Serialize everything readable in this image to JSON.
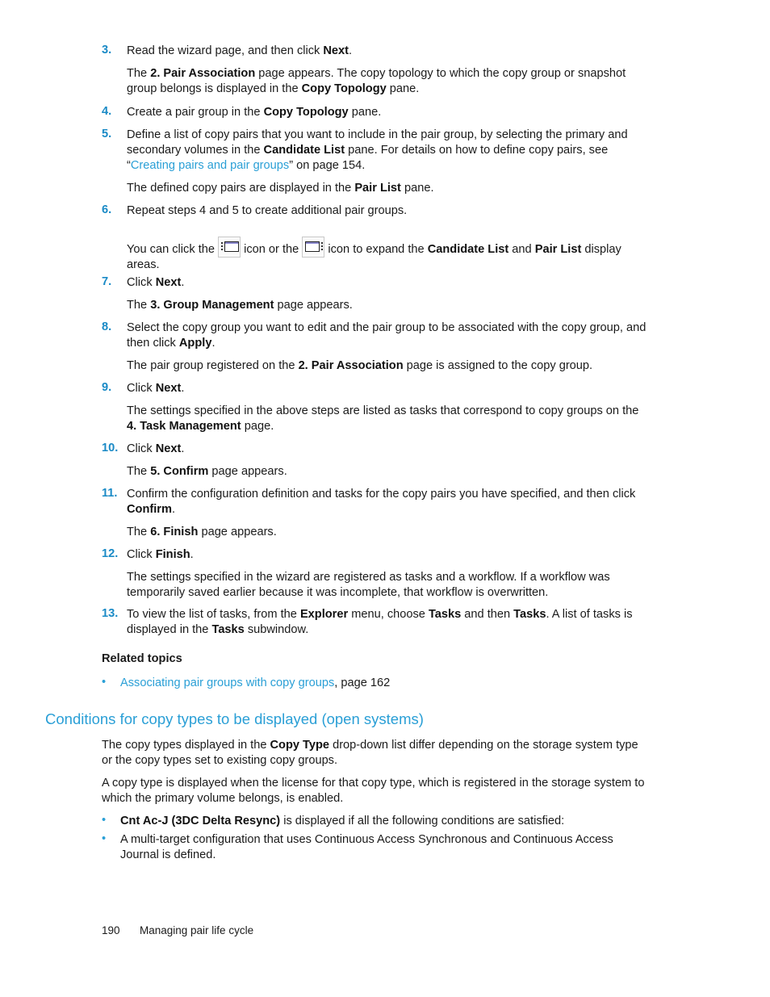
{
  "steps": [
    {
      "num": "3.",
      "line": [
        "Read the wizard page, and then click ",
        "Next",
        "."
      ],
      "note": [
        "The ",
        "2. Pair Association",
        " page appears. The copy topology to which the copy group or snapshot group belongs is displayed in the ",
        "Copy Topology",
        " pane."
      ]
    },
    {
      "num": "4.",
      "line": [
        "Create a pair group in the ",
        "Copy Topology",
        " pane."
      ]
    },
    {
      "num": "5.",
      "line": [
        "Define a list of copy pairs that you want to include in the pair group, by selecting the primary and secondary volumes in the ",
        "Candidate List",
        " pane. For details on how to define copy pairs, see “",
        "Creating pairs and pair groups",
        "” on page 154."
      ],
      "note": [
        "The defined copy pairs are displayed in the ",
        "Pair List",
        " pane."
      ]
    },
    {
      "num": "6.",
      "line": [
        "Repeat steps 4 and 5 to create additional pair groups."
      ],
      "note": [
        "You can click the ",
        " icon or the ",
        " icon to expand the ",
        "Candidate List",
        " and ",
        "Pair List",
        " display areas."
      ]
    },
    {
      "num": "7.",
      "line": [
        "Click ",
        "Next",
        "."
      ],
      "note": [
        "The ",
        "3. Group Management",
        " page appears."
      ]
    },
    {
      "num": "8.",
      "line": [
        "Select the copy group you want to edit and the pair group to be associated with the copy group, and then click ",
        "Apply",
        "."
      ],
      "note": [
        "The pair group registered on the ",
        "2. Pair Association",
        " page is assigned to the copy group."
      ]
    },
    {
      "num": "9.",
      "line": [
        "Click ",
        "Next",
        "."
      ],
      "note": [
        "The settings specified in the above steps are listed as tasks that correspond to copy groups on the ",
        "4. Task Management",
        " page."
      ]
    },
    {
      "num": "10.",
      "line": [
        "Click ",
        "Next",
        "."
      ],
      "note": [
        "The ",
        "5. Confirm",
        " page appears."
      ]
    },
    {
      "num": "11.",
      "line": [
        "Confirm the configuration definition and tasks for the copy pairs you have specified, and then click ",
        "Confirm",
        "."
      ],
      "note": [
        "The ",
        "6. Finish",
        " page appears."
      ]
    },
    {
      "num": "12.",
      "line": [
        "Click ",
        "Finish",
        "."
      ],
      "note": [
        "The settings specified in the wizard are registered as tasks and a workflow. If a workflow was temporarily saved earlier because it was incomplete, that workflow is overwritten."
      ]
    },
    {
      "num": "13.",
      "line": [
        "To view the list of tasks, from the ",
        "Explorer",
        " menu, choose ",
        "Tasks",
        " and then ",
        "Tasks",
        ". A list of tasks is displayed in the ",
        "Tasks",
        " subwindow."
      ]
    }
  ],
  "icons": {
    "expand_left": "expand-candidate-list-icon",
    "expand_right": "expand-pair-list-icon"
  },
  "related": {
    "title": "Related topics",
    "bullet": "•",
    "link": "Associating pair groups with copy groups",
    "suffix": ", page 162"
  },
  "section": {
    "heading": "Conditions for copy types to be displayed (open systems)",
    "p1": [
      "The copy types displayed in the ",
      "Copy Type",
      " drop-down list differ depending on the storage system type or the copy types set to existing copy groups."
    ],
    "p2": "A copy type is displayed when the license for that copy type, which is registered in the storage system to which the primary volume belongs, is enabled.",
    "bullets": [
      [
        "Cnt Ac-J (3DC Delta Resync)",
        " is displayed if all the following conditions are satisfied:"
      ],
      [
        "A multi-target configuration that uses Continuous Access Synchronous and Continuous Access Journal is defined."
      ]
    ]
  },
  "footer": {
    "page": "190",
    "title": "Managing pair life cycle"
  },
  "colors": {
    "accent": "#1a8ac6",
    "link": "#2a9fd6"
  }
}
